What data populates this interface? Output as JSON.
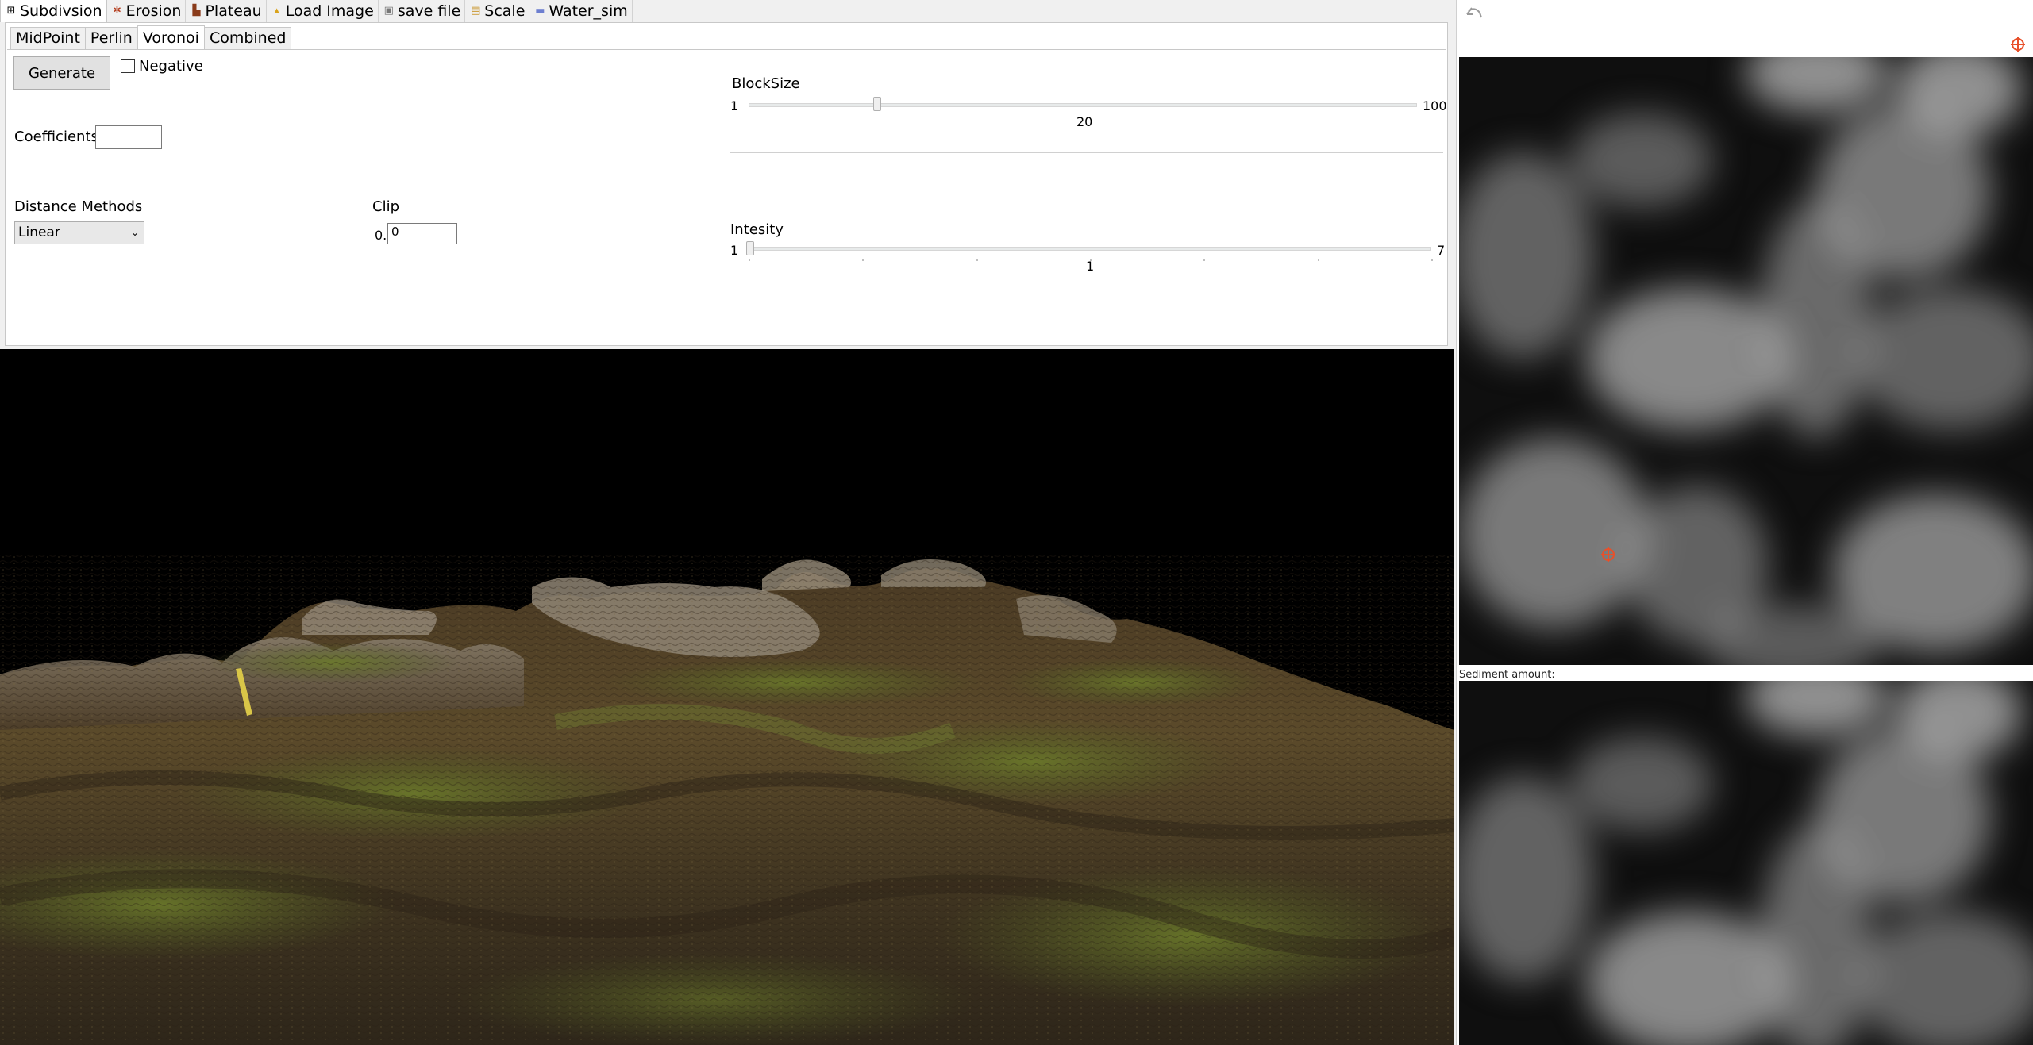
{
  "top_tabs": [
    {
      "label": "Subdivsion",
      "icon": "grid-icon"
    },
    {
      "label": "Erosion",
      "icon": "leaf-icon"
    },
    {
      "label": "Plateau",
      "icon": "mesa-icon"
    },
    {
      "label": "Load Image",
      "icon": "image-icon"
    },
    {
      "label": "save file",
      "icon": "save-icon"
    },
    {
      "label": "Scale",
      "icon": "scale-icon"
    },
    {
      "label": "Water_sim",
      "icon": "water-icon"
    }
  ],
  "sub_tabs": [
    "MidPoint",
    "Perlin",
    "Voronoi",
    "Combined"
  ],
  "active_sub_tab": "Voronoi",
  "controls": {
    "generate_label": "Generate",
    "negative_label": "Negative",
    "negative_checked": false,
    "coefficients_label": "Coefficients",
    "coefficients_value": "",
    "distance_label": "Distance Methods",
    "distance_value": "Linear",
    "clip_label": "Clip",
    "clip_prefix": "0.",
    "clip_value": "0",
    "blocksize": {
      "label": "BlockSize",
      "min": "1",
      "max": "100",
      "value": "20",
      "value_num": 20
    },
    "intensity": {
      "label": "Intesity",
      "min": "1",
      "max": "7",
      "value": "1",
      "value_num": 1
    }
  },
  "right_panel": {
    "sediment_label": "Sediment amount:"
  },
  "colors": {
    "accent_target": "#e8502a",
    "panel_bg": "#ffffff",
    "window_bg": "#f0f0f0"
  }
}
